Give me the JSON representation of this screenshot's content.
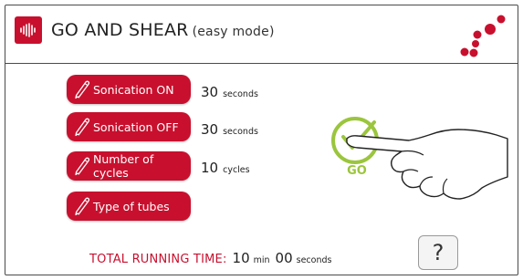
{
  "header": {
    "title": "GO AND SHEAR",
    "mode": "(easy mode)",
    "app_icon": "waveform-icon",
    "brand_icon": "dots-logo-icon"
  },
  "params": [
    {
      "label": "Sonication ON",
      "value": "30",
      "unit": "seconds"
    },
    {
      "label": "Sonication OFF",
      "value": "30",
      "unit": "seconds"
    },
    {
      "label": "Number of cycles",
      "value": "10",
      "unit": "cycles"
    },
    {
      "label": "Type of tubes",
      "value": "",
      "unit": ""
    }
  ],
  "go": {
    "label": "GO"
  },
  "total": {
    "label": "TOTAL RUNNING TIME:",
    "minutes": "10",
    "min_unit": "min",
    "seconds": "00",
    "sec_unit": "seconds"
  },
  "help": {
    "label": "?"
  },
  "colors": {
    "accent": "#c8102e",
    "go": "#9bc53d",
    "text": "#222222"
  }
}
